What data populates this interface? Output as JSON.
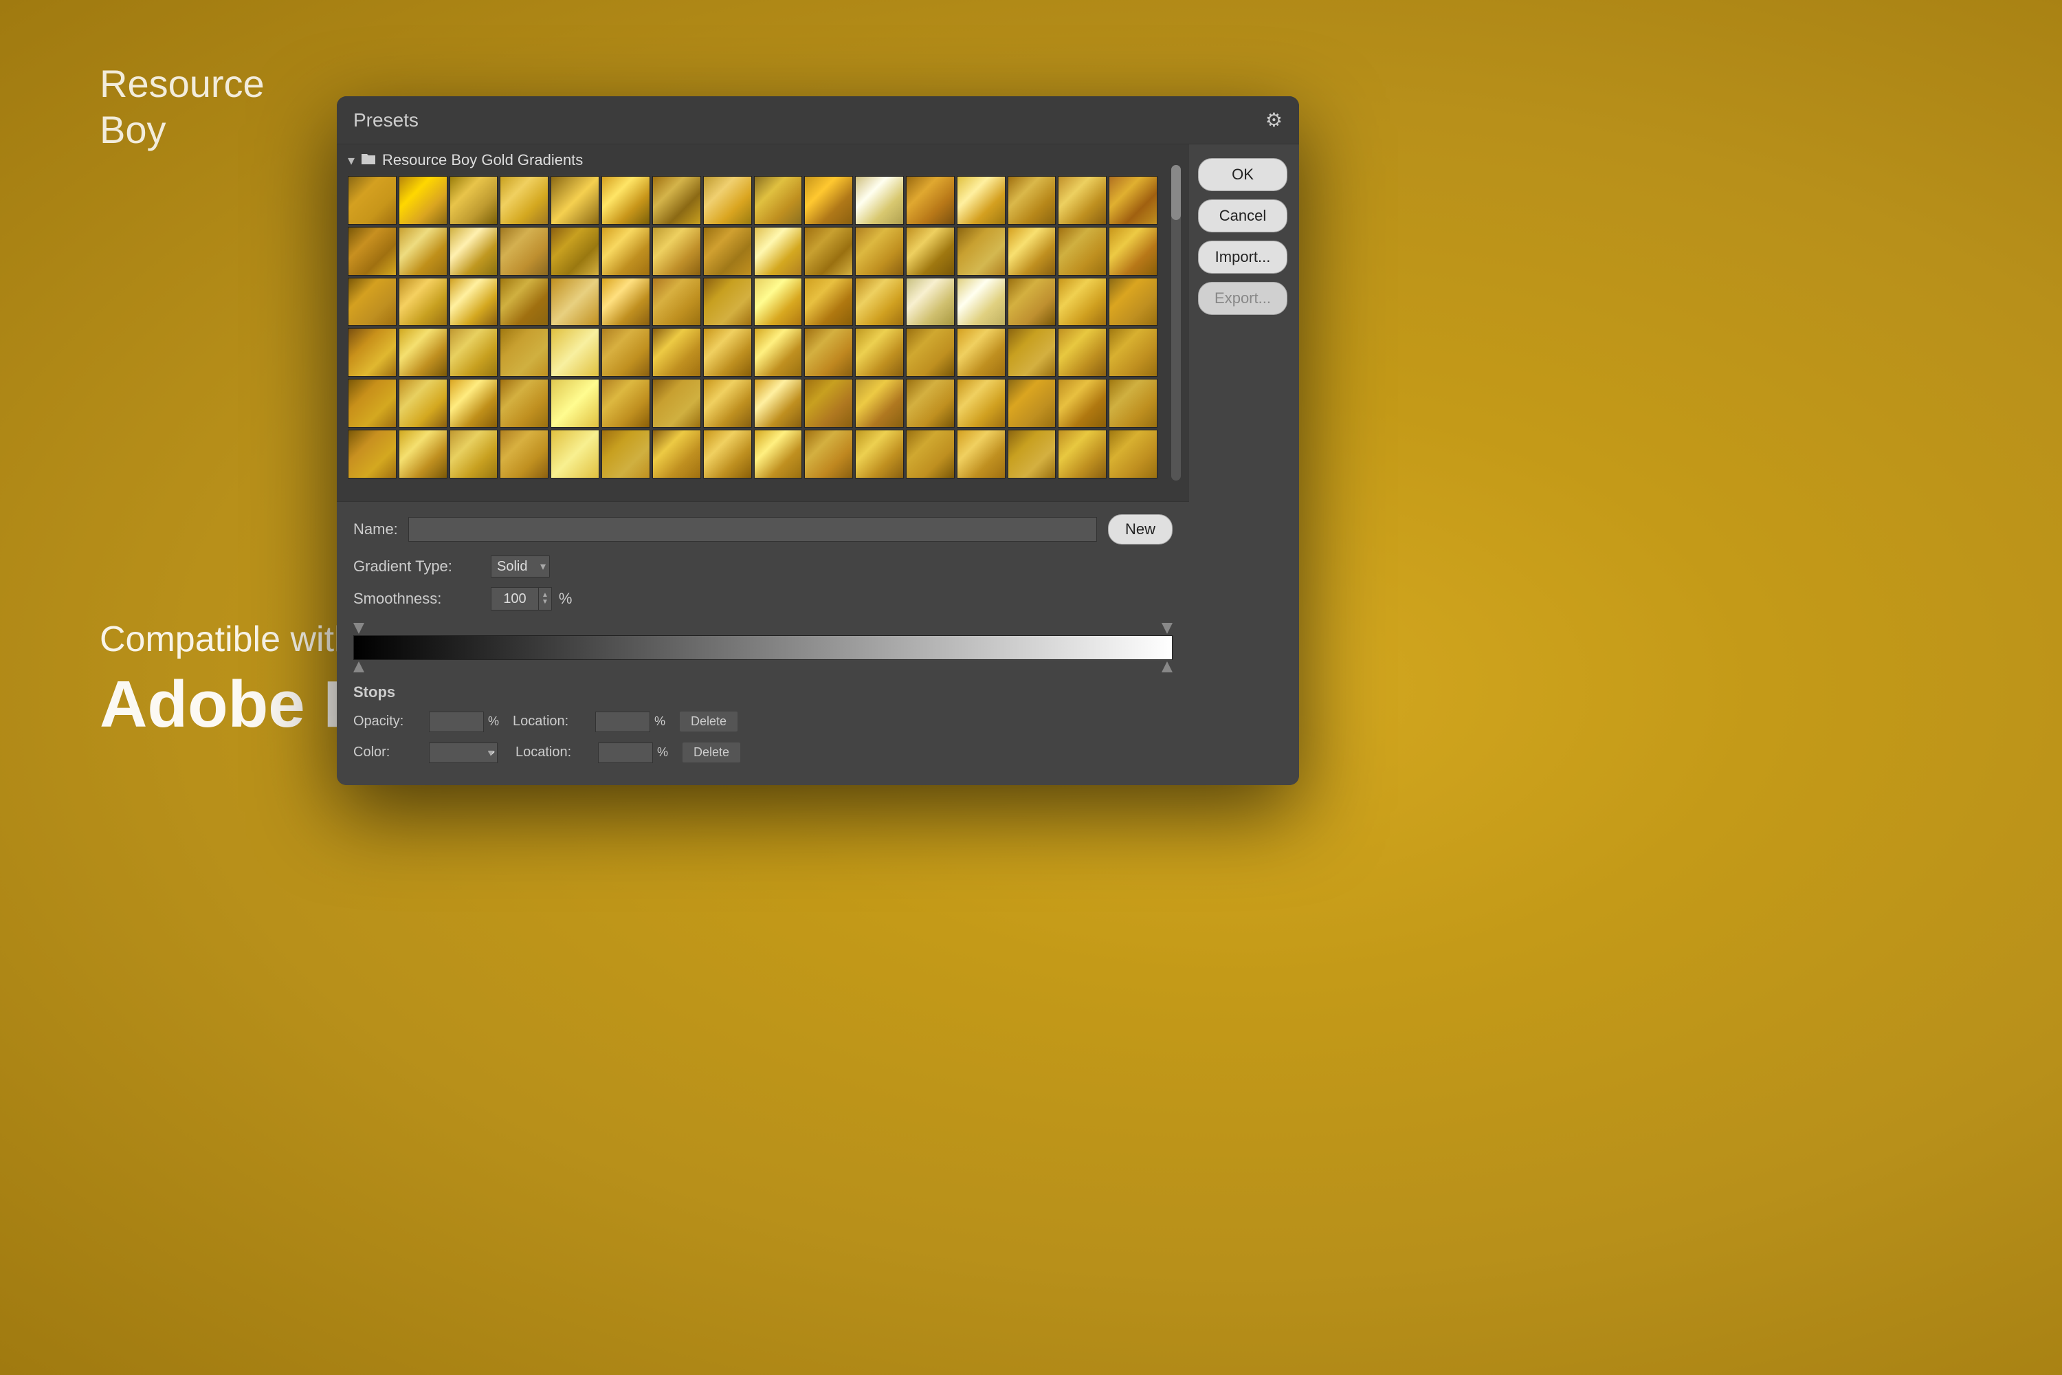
{
  "brand": {
    "line1": "Resource",
    "line2": "Boy"
  },
  "compat": {
    "line1": "Compatible with",
    "line2": "Adobe Photoshop"
  },
  "dialog": {
    "presets_label": "Presets",
    "folder_name": "Resource Boy Gold Gradients",
    "name_label": "Name:",
    "name_placeholder": "",
    "gradient_type_label": "Gradient Type:",
    "gradient_type_value": "Solid",
    "smoothness_label": "Smoothness:",
    "smoothness_value": "100",
    "smoothness_unit": "%",
    "stops_label": "Stops",
    "opacity_label": "Opacity:",
    "opacity_unit": "%",
    "opacity_location_label": "Location:",
    "opacity_location_unit": "%",
    "opacity_delete": "Delete",
    "color_label": "Color:",
    "color_location_label": "Location:",
    "color_location_unit": "%",
    "color_delete": "Delete",
    "buttons": {
      "ok": "OK",
      "cancel": "Cancel",
      "import": "Import...",
      "export": "Export...",
      "new": "New"
    }
  }
}
